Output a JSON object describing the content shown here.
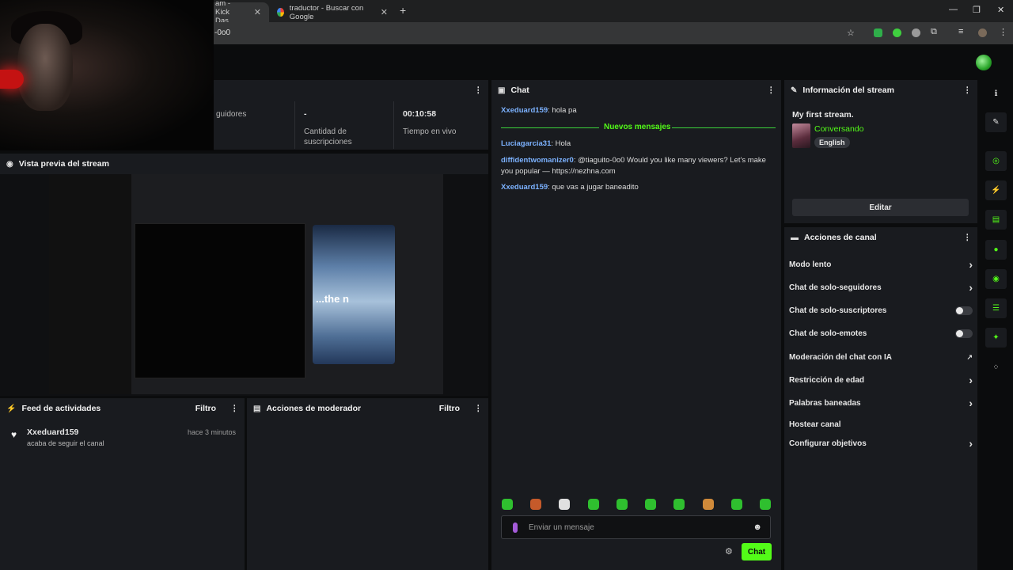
{
  "browser": {
    "tabs": [
      {
        "title": "am - Kick Das",
        "close": "✕"
      },
      {
        "title": "traductor - Buscar con Google",
        "close": "✕"
      }
    ],
    "new_tab": "+",
    "url": "-0o0",
    "window_controls": [
      "—",
      "❐",
      "✕"
    ]
  },
  "stats": {
    "followers_label": "guidores",
    "subs_value": "-",
    "subs_label": "Cantidad de suscripciones",
    "live_value": "00:10:58",
    "live_label": "Tiempo en vivo"
  },
  "preview": {
    "title": "Vista previa del stream",
    "overlay_text": "...the n"
  },
  "feed": {
    "title": "Feed de actividades",
    "filter": "Filtro",
    "items": [
      {
        "user": "Xxeduard159",
        "action": "acaba de seguir el canal",
        "time": "hace 3 minutos"
      }
    ]
  },
  "mod": {
    "title": "Acciones de moderador",
    "filter": "Filtro"
  },
  "chat": {
    "title": "Chat",
    "new_messages": "Nuevos mensajes",
    "messages": [
      {
        "user": "Xxeduard159",
        "text": ": hola pa"
      },
      {
        "user": "Luciagarcia31",
        "text": ": Hola"
      },
      {
        "user": "diffidentwomanizer0",
        "text": ": @tiaguito-0o0 Would you like many viewers? Let's make you popular — https://nezhna.com"
      },
      {
        "user": "Xxeduard159",
        "text": ": que vas a jugar baneadito"
      }
    ],
    "input_placeholder": "Enviar un mensaje",
    "send_label": "Chat",
    "emote_count": 10
  },
  "stream_info": {
    "title": "Información del stream",
    "stream_title": "My first stream.",
    "category": "Conversando",
    "language": "English",
    "edit_label": "Editar"
  },
  "channel_actions": {
    "title": "Acciones de canal",
    "items": [
      {
        "label": "Modo lento",
        "control": "chevron"
      },
      {
        "label": "Chat de solo-seguidores",
        "control": "chevron"
      },
      {
        "label": "Chat de solo-suscriptores",
        "control": "toggle",
        "on": false
      },
      {
        "label": "Chat de solo-emotes",
        "control": "toggle",
        "on": false
      },
      {
        "label": "Moderación del chat con IA",
        "control": "external"
      },
      {
        "label": "Restricción de edad",
        "control": "chevron"
      },
      {
        "label": "Palabras baneadas",
        "control": "chevron"
      },
      {
        "label": "Hostear canal",
        "control": "none"
      },
      {
        "label": "Configurar objetivos",
        "control": "chevron"
      }
    ]
  },
  "colors": {
    "accent": "#53fc18",
    "panel": "#191b1f",
    "background": "#0b0c0d",
    "username_blue": "#7cb2ff"
  }
}
